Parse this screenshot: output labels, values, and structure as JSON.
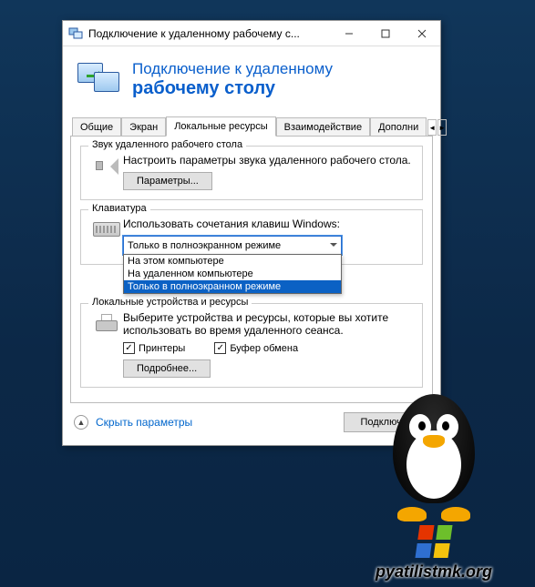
{
  "window": {
    "title": "Подключение к удаленному рабочему с..."
  },
  "header": {
    "line1": "Подключение к удаленному",
    "line2": "рабочему столу"
  },
  "tabs": [
    "Общие",
    "Экран",
    "Локальные ресурсы",
    "Взаимодействие",
    "Дополни"
  ],
  "active_tab": 2,
  "audio": {
    "legend": "Звук удаленного рабочего стола",
    "desc": "Настроить параметры звука удаленного рабочего стола.",
    "button": "Параметры..."
  },
  "keyboard": {
    "legend": "Клавиатура",
    "desc": "Использовать сочетания клавиш Windows:",
    "selected": "Только в полноэкранном режиме",
    "options": [
      "На этом компьютере",
      "На удаленном компьютере",
      "Только в полноэкранном режиме"
    ],
    "highlighted": 2
  },
  "local": {
    "legend": "Локальные устройства и ресурсы",
    "desc": "Выберите устройства и ресурсы, которые вы хотите использовать во время удаленного сеанса.",
    "printers": "Принтеры",
    "clipboard": "Буфер обмена",
    "printers_checked": true,
    "clipboard_checked": true,
    "more": "Подробнее..."
  },
  "footer": {
    "collapse": "Скрыть параметры",
    "connect": "Подключит"
  },
  "watermark": "pyatilistmk.org"
}
